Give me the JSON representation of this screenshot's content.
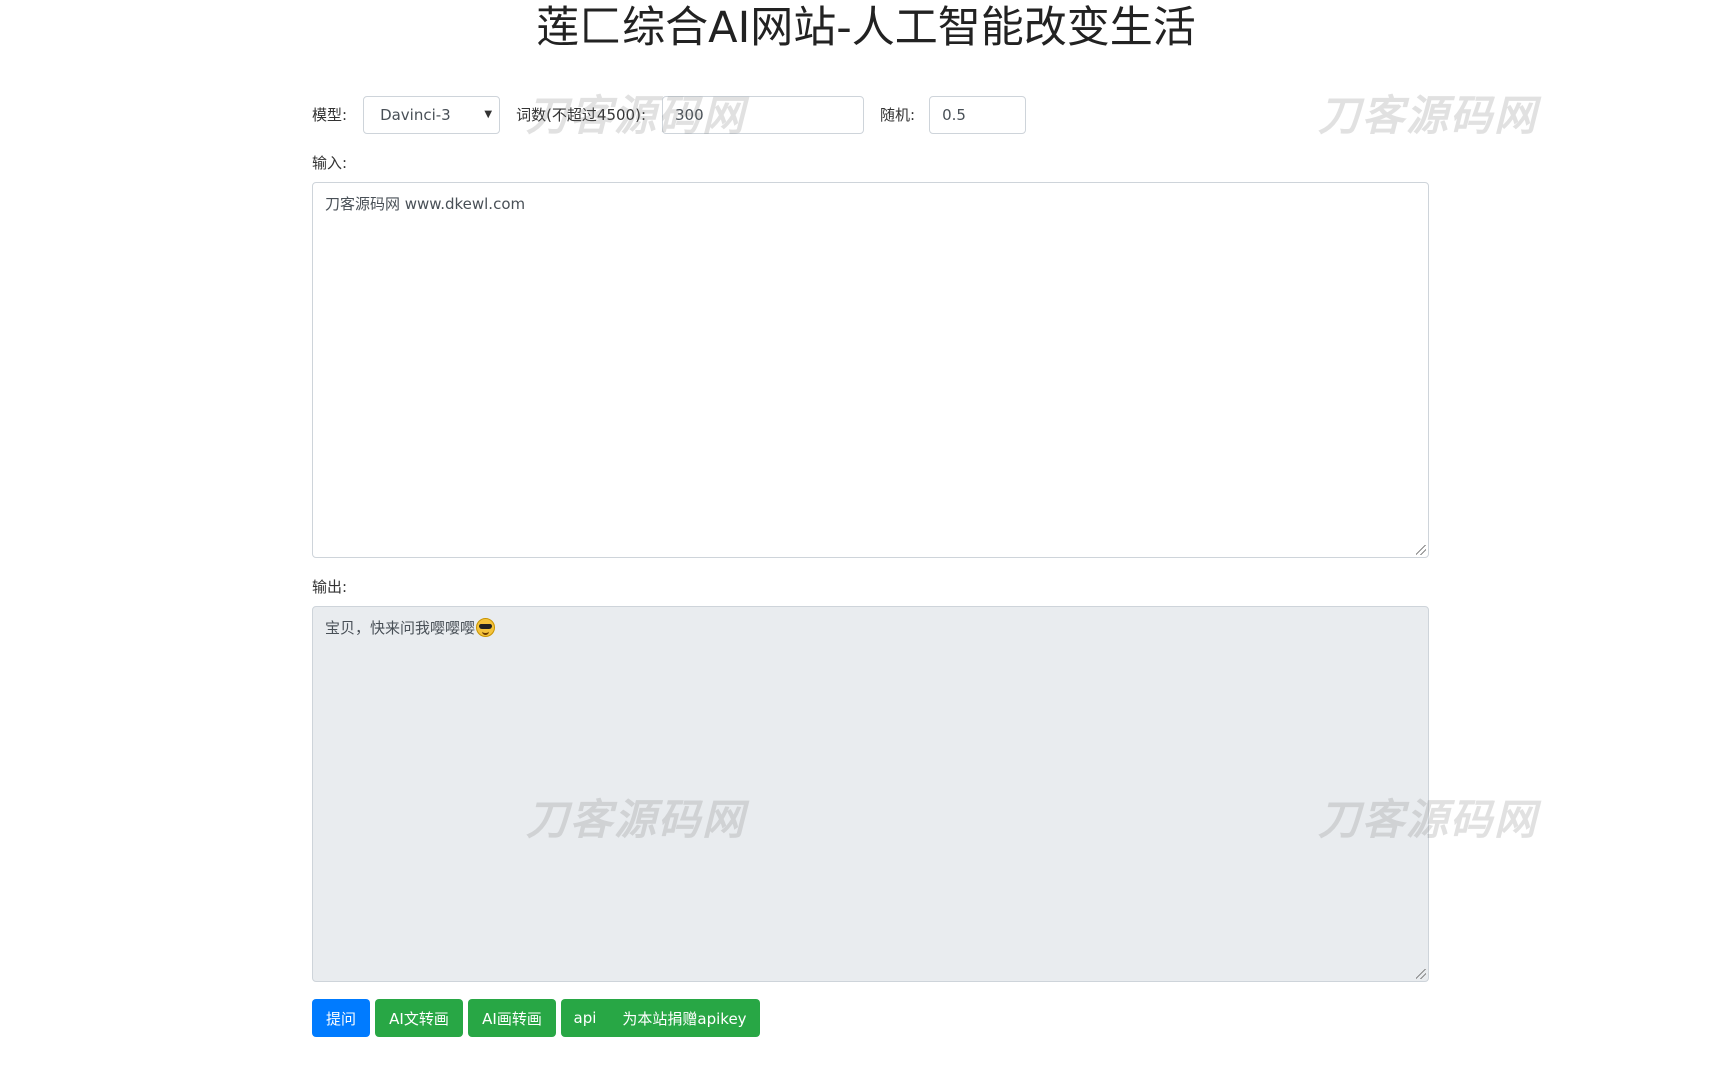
{
  "page": {
    "title": "莲匚综合AI网站-人工智能改变生活"
  },
  "params": {
    "model_label": "模型:",
    "model_value": "Davinci-3",
    "words_label": "词数(不超过4500):",
    "words_value": "300",
    "random_label": "随机:",
    "random_value": "0.5"
  },
  "input": {
    "label": "输入:",
    "value": "刀客源码网  www.dkewl.com"
  },
  "output": {
    "label": "输出:",
    "value": "宝贝，快来问我嘤嘤嘤",
    "emoji": "smiling-face-with-sunglasses-icon"
  },
  "buttons": {
    "ask": "提问",
    "ai_text_to_image": "AI文转画",
    "ai_image_to_image": "AI画转画",
    "api": "api",
    "donate": "为本站捐赠apikey"
  },
  "watermarks": [
    "刀客源码网",
    "刀客源码网",
    "刀客源码网",
    "刀客源码网"
  ],
  "colors": {
    "primary": "#007bff",
    "success": "#28a745",
    "readonly_bg": "#e9ecef",
    "border": "#ced4da"
  }
}
